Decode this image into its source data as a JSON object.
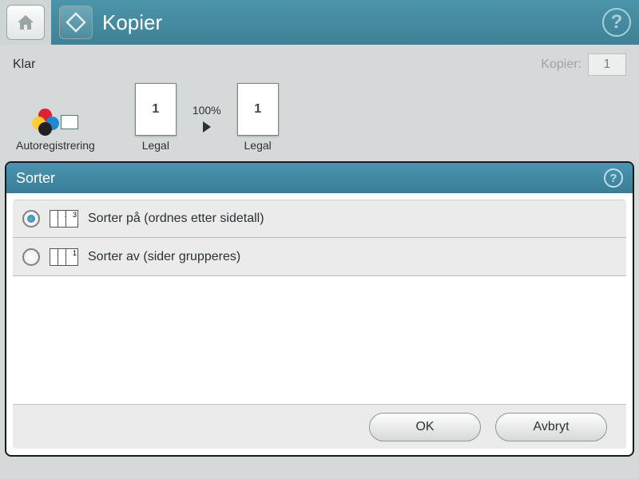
{
  "header": {
    "title": "Kopier"
  },
  "status": {
    "ready": "Klar",
    "copies_label": "Kopier:",
    "copies_value": "1"
  },
  "preview": {
    "auto_label": "Autoregistrering",
    "source_size": "Legal",
    "source_page_num": "1",
    "zoom": "100%",
    "dest_size": "Legal",
    "dest_page_num": "1"
  },
  "dialog": {
    "title": "Sorter",
    "options": [
      {
        "label": "Sorter på (ordnes etter sidetall)",
        "selected": true,
        "pages": [
          "1",
          "2",
          "3"
        ]
      },
      {
        "label": "Sorter av (sider grupperes)",
        "selected": false,
        "pages": [
          "1",
          "1",
          "1"
        ]
      }
    ],
    "ok": "OK",
    "cancel": "Avbryt"
  }
}
